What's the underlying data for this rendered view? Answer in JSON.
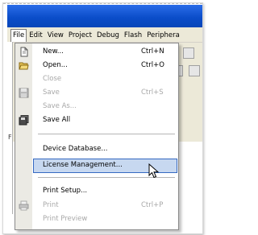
{
  "menubar": {
    "items": [
      "File",
      "Edit",
      "View",
      "Project",
      "Debug",
      "Flash",
      "Periphera"
    ]
  },
  "toolbar": {
    "panel_label": "F"
  },
  "file_menu": {
    "new": {
      "label": "New...",
      "shortcut": "Ctrl+N"
    },
    "open": {
      "label": "Open...",
      "shortcut": "Ctrl+O"
    },
    "close": {
      "label": "Close"
    },
    "save": {
      "label": "Save",
      "shortcut": "Ctrl+S"
    },
    "save_as": {
      "label": "Save As..."
    },
    "save_all": {
      "label": "Save All"
    },
    "device_database": {
      "label": "Device Database..."
    },
    "license_management": {
      "label": "License Management..."
    },
    "print_setup": {
      "label": "Print Setup..."
    },
    "print": {
      "label": "Print",
      "shortcut": "Ctrl+P"
    },
    "print_preview": {
      "label": "Print Preview"
    }
  },
  "colors": {
    "menu_background": "#ffffff",
    "icon_gutter": "#ebeae4",
    "highlight_fill": "#c7d8f0",
    "highlight_border": "#3569c1",
    "disabled_text": "#a8a8a8",
    "titlebar": "#0a4cc8"
  },
  "icons": [
    "new-file-icon",
    "open-folder-icon",
    "save-disk-icon",
    "save-all-icon",
    "print-icon",
    "mouse-pointer-icon"
  ]
}
